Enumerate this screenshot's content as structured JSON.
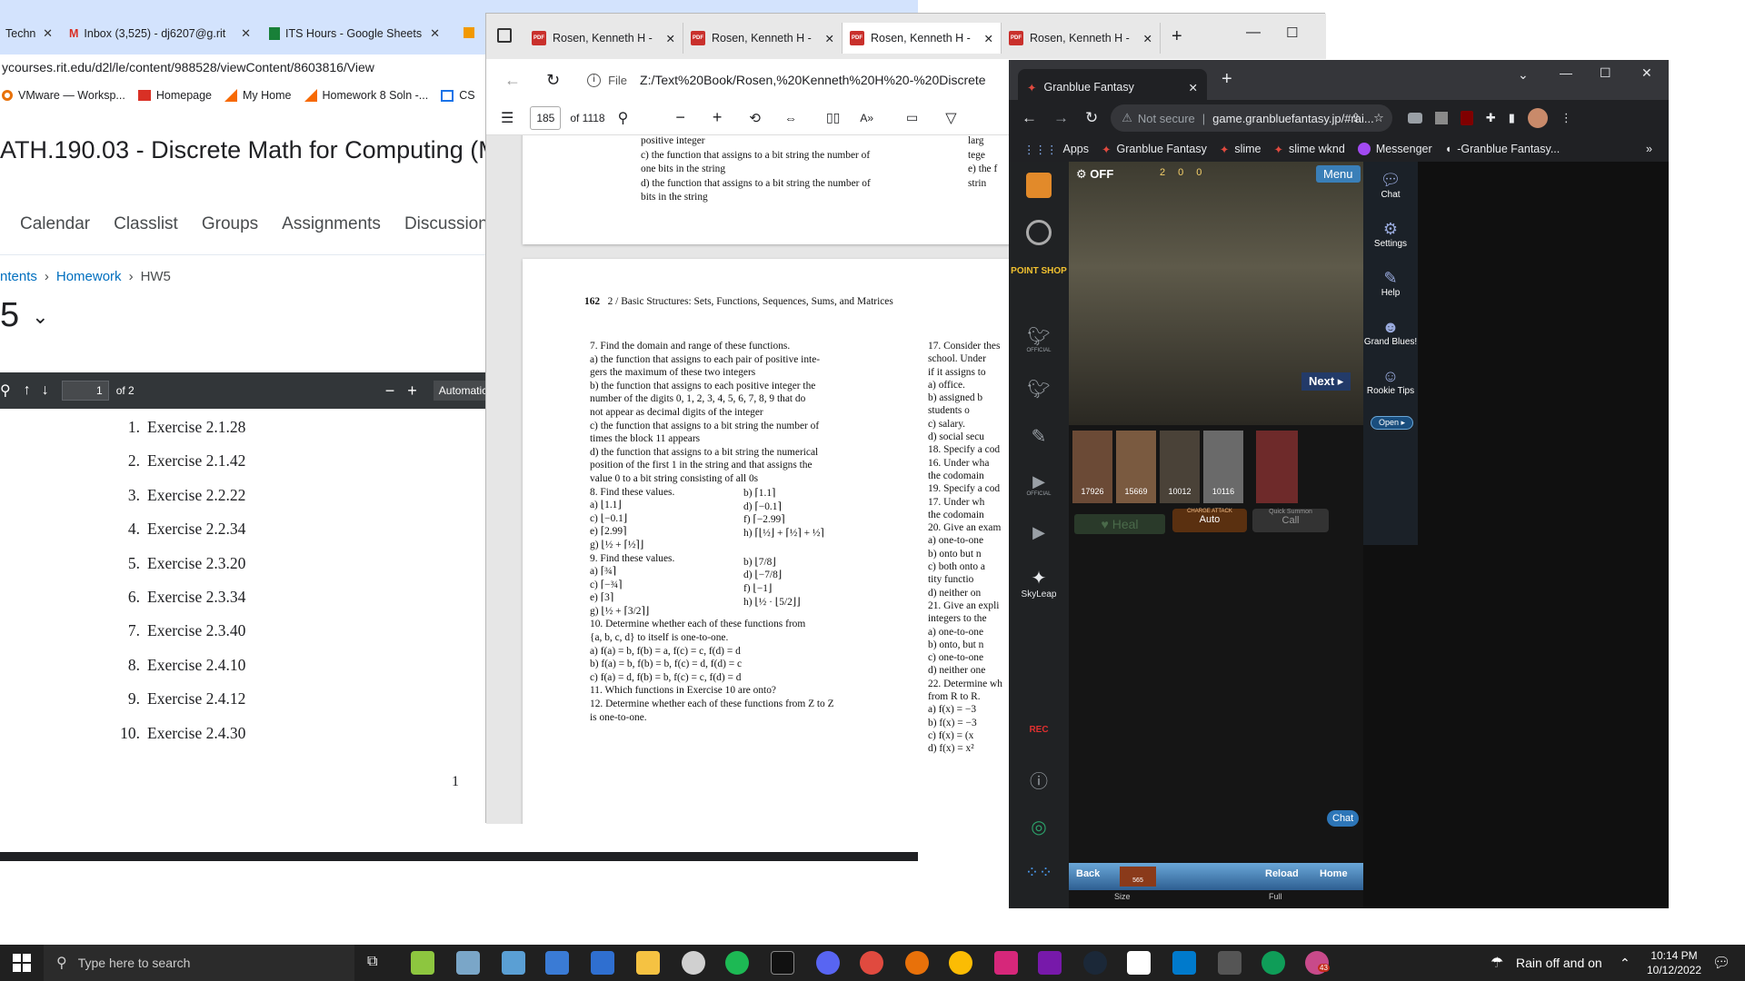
{
  "browser1": {
    "tabs": [
      "Techn",
      "Inbox (3,525) - dj6207@g.rit",
      "ITS Hours - Google Sheets"
    ],
    "url": "ycourses.rit.edu/d2l/le/content/988528/viewContent/8603816/View",
    "bookmarks": [
      "VMware — Worksp...",
      "Homepage",
      "My Home",
      "Homework 8 Soln -...",
      "CS"
    ],
    "course_title": "ATH.190.03 - Discrete Math for Computing (M",
    "nav": [
      "Calendar",
      "Classlist",
      "Groups",
      "Assignments",
      "Discussions"
    ],
    "breadcrumb": [
      "ntents",
      "Homework",
      "HW5"
    ],
    "hw_title": "5",
    "pdf_toolbar": {
      "page_value": "1",
      "page_count": "of 2",
      "zoom": "Automatic"
    },
    "exercises": [
      {
        "n": "1.",
        "t": "Exercise 2.1.28"
      },
      {
        "n": "2.",
        "t": "Exercise 2.1.42"
      },
      {
        "n": "3.",
        "t": "Exercise 2.2.22"
      },
      {
        "n": "4.",
        "t": "Exercise 2.2.34"
      },
      {
        "n": "5.",
        "t": "Exercise 2.3.20"
      },
      {
        "n": "6.",
        "t": "Exercise 2.3.34"
      },
      {
        "n": "7.",
        "t": "Exercise 2.3.40"
      },
      {
        "n": "8.",
        "t": "Exercise 2.4.10"
      },
      {
        "n": "9.",
        "t": "Exercise 2.4.12"
      },
      {
        "n": "10.",
        "t": "Exercise 2.4.30"
      }
    ],
    "page_number": "1"
  },
  "browser2": {
    "tabs": [
      "Rosen, Kenneth H -",
      "Rosen, Kenneth H -",
      "Rosen, Kenneth H -",
      "Rosen, Kenneth H -"
    ],
    "file_label": "File",
    "url": "Z:/Text%20Book/Rosen,%20Kenneth%20H%20-%20Discrete%2",
    "page_value": "185",
    "page_count": "of 1118",
    "page_top": {
      "lines_a": [
        "positive integer",
        "c)  the function that assigns to a bit string the number of",
        "one bits in the string",
        "d)  the function that assigns to a bit string the number of",
        "bits in the string"
      ],
      "lines_b": [
        "larg",
        "tege",
        "e)  the f",
        "strin"
      ]
    },
    "page_header": {
      "num": "162",
      "text": "2 / Basic Structures:  Sets, Functions, Sequences, Sums, and Matrices"
    },
    "left_col": [
      "7.  Find the domain and range of these functions.",
      "a)  the function that assigns to each pair of positive inte-",
      "gers the maximum of these two integers",
      "b)  the function that assigns to each positive integer the",
      "number of the digits 0, 1, 2, 3, 4, 5, 6, 7, 8, 9 that do",
      "not appear as decimal digits of the integer",
      "c)  the function that assigns to a bit string the number of",
      "times the block 11 appears",
      "d)  the function that assigns to a bit string the numerical",
      "position of the first 1 in the string and that assigns the",
      "value 0 to a bit string consisting of all 0s",
      "8.  Find these values.",
      "a)  ⌊1.1⌋",
      "c)  ⌊−0.1⌋",
      "e)  ⌈2.99⌉",
      "g)  ⌊½ + ⌈½⌉⌋",
      "9.  Find these values.",
      "a)  ⌈¾⌉",
      "c)  ⌈−¾⌉",
      "e)  ⌈3⌉",
      "g)  ⌊½ + ⌈3/2⌉⌋",
      "10.  Determine whether each of these functions from",
      "{a, b, c, d} to itself is one-to-one.",
      "a)  f(a) = b, f(b) = a, f(c) = c, f(d) = d",
      "b)  f(a) = b, f(b) = b, f(c) = d, f(d) = c",
      "c)  f(a) = d, f(b) = b, f(c) = c, f(d) = d",
      "11.  Which functions in Exercise 10 are onto?",
      "12.  Determine whether each of these functions from Z to Z",
      "is one-to-one."
    ],
    "mid_col": [
      "b)  ⌈1.1⌉",
      "d)  ⌈−0.1⌉",
      "f)  ⌈−2.99⌉",
      "h)  ⌈⌊½⌋ + ⌈½⌉ + ½⌉",
      "b)  ⌊7/8⌋",
      "d)  ⌊−7/8⌋",
      "f)  ⌊−1⌋",
      "h)  ⌊½ · ⌊5/2⌋⌋"
    ],
    "right_col": [
      "17.  Consider thes",
      "school. Under",
      "if it assigns to",
      "a)  office.",
      "b)  assigned b",
      "students o",
      "c)  salary.",
      "d)  social secu",
      "18.  Specify a cod",
      "16. Under wha",
      "the codomain",
      "19.  Specify a cod",
      "17. Under wh",
      "the codomain",
      "20.  Give an exam",
      "a)  one-to-one",
      "b)  onto but n",
      "c)  both onto a",
      "tity functio",
      "d)  neither on",
      "21.  Give an expli",
      "integers to the",
      "a)  one-to-one",
      "b)  onto, but n",
      "c)  one-to-one",
      "d)  neither one",
      "22.  Determine wh",
      "from R to R.",
      "a)  f(x) = −3",
      "b)  f(x) = −3",
      "c)  f(x) = (x",
      "d)  f(x) = x²"
    ]
  },
  "browser3": {
    "tab_title": "Granblue Fantasy",
    "not_secure": "Not secure",
    "url": "game.granbluefantasy.jp/#rai...",
    "bookmarks": [
      "Apps",
      "Granblue Fantasy",
      "slime",
      "slime wknd",
      "Messenger",
      "-Granblue Fantasy..."
    ],
    "side_labels": [
      "POINT SHOP",
      "OFFICIAL",
      "OFFICIAL",
      "SkyLeap",
      "REC"
    ],
    "game": {
      "auto_label": "OFF",
      "menu": "Menu",
      "counters": [
        "2",
        "0",
        "0"
      ],
      "next": "Next",
      "hp": [
        "17926",
        "15669",
        "10012",
        "10116"
      ],
      "heal": "Heal",
      "charge_attack": "CHARGE ATTACK",
      "auto": "Auto",
      "quick_summon": "Quick Summon",
      "call": "Call",
      "back": "Back",
      "reload": "Reload",
      "home": "Home",
      "count": "565",
      "size": "Size",
      "full": "Full",
      "chat": "Chat"
    },
    "right_menu": [
      "Chat",
      "Settings",
      "Help",
      "Grand Blues!",
      "Rookie Tips",
      "Open"
    ]
  },
  "taskbar": {
    "search_placeholder": "Type here to search",
    "weather": "Rain off and on",
    "time": "10:14 PM",
    "date": "10/12/2022",
    "badge": "43"
  },
  "colors": {
    "accent": "#0078d4",
    "pdf_red": "#c9302c",
    "rit_orange": "#f76902"
  }
}
